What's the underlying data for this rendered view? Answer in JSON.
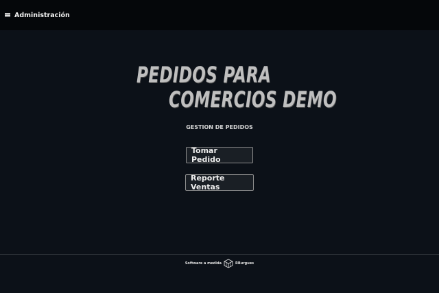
{
  "topbar": {
    "menu_icon": "hamburger-menu-icon",
    "title": "Administración"
  },
  "hero": {
    "line1": "PEDIDOS PARA",
    "line2": "COMERCIOS DEMO"
  },
  "subtitle": "GESTION DE PEDIDOS",
  "actions": {
    "take_order": "Tomar Pedido",
    "sales_report": "Reporte Ventas"
  },
  "footer": {
    "text": "Software a medida",
    "brand": "RBurgues",
    "logo_icon": "cube-logo-icon"
  },
  "colors": {
    "background": "#0c1118",
    "topbar": "#05070a",
    "title_text": "#bfbfbf"
  }
}
